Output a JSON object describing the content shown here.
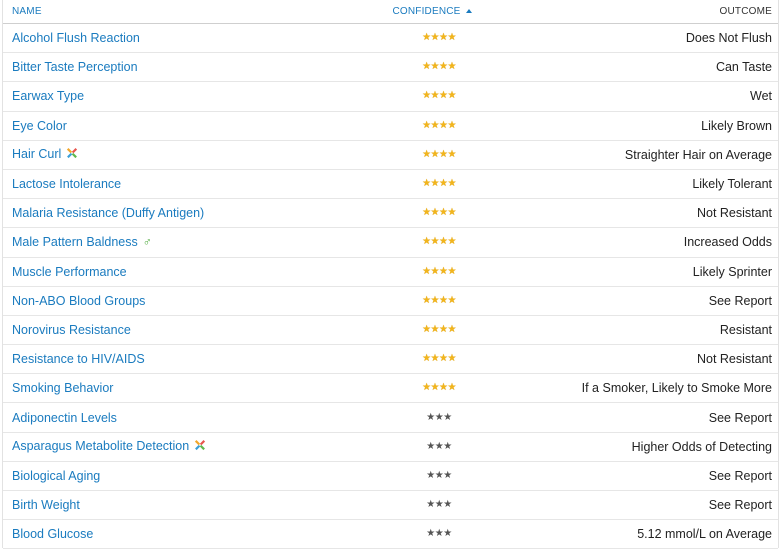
{
  "header": {
    "name_label": "NAME",
    "confidence_label": "CONFIDENCE",
    "outcome_label": "OUTCOME",
    "sort_icon": "sort-ascending-icon"
  },
  "colors": {
    "link": "#1a7bbf",
    "star_high": "#f2b51c",
    "star_low": "#555555",
    "male_symbol": "#4caa3a"
  },
  "rows": [
    {
      "name": "Alcohol Flush Reaction",
      "confidence": 4,
      "stars": "★★★★",
      "outcome": "Does Not Flush",
      "badge": ""
    },
    {
      "name": "Bitter Taste Perception",
      "confidence": 4,
      "stars": "★★★★",
      "outcome": "Can Taste",
      "badge": ""
    },
    {
      "name": "Earwax Type",
      "confidence": 4,
      "stars": "★★★★",
      "outcome": "Wet",
      "badge": ""
    },
    {
      "name": "Eye Color",
      "confidence": 4,
      "stars": "★★★★",
      "outcome": "Likely Brown",
      "badge": ""
    },
    {
      "name": "Hair Curl",
      "confidence": 4,
      "stars": "★★★★",
      "outcome": "Straighter Hair on Average",
      "badge": "multi-gene-icon"
    },
    {
      "name": "Lactose Intolerance",
      "confidence": 4,
      "stars": "★★★★",
      "outcome": "Likely Tolerant",
      "badge": ""
    },
    {
      "name": "Malaria Resistance (Duffy Antigen)",
      "confidence": 4,
      "stars": "★★★★",
      "outcome": "Not Resistant",
      "badge": ""
    },
    {
      "name": "Male Pattern Baldness",
      "confidence": 4,
      "stars": "★★★★",
      "outcome": "Increased Odds",
      "badge": "male-icon"
    },
    {
      "name": "Muscle Performance",
      "confidence": 4,
      "stars": "★★★★",
      "outcome": "Likely Sprinter",
      "badge": ""
    },
    {
      "name": "Non-ABO Blood Groups",
      "confidence": 4,
      "stars": "★★★★",
      "outcome": "See Report",
      "badge": ""
    },
    {
      "name": "Norovirus Resistance",
      "confidence": 4,
      "stars": "★★★★",
      "outcome": "Resistant",
      "badge": ""
    },
    {
      "name": "Resistance to HIV/AIDS",
      "confidence": 4,
      "stars": "★★★★",
      "outcome": "Not Resistant",
      "badge": ""
    },
    {
      "name": "Smoking Behavior",
      "confidence": 4,
      "stars": "★★★★",
      "outcome": "If a Smoker, Likely to Smoke More",
      "badge": ""
    },
    {
      "name": "Adiponectin Levels",
      "confidence": 3,
      "stars": "★★★",
      "outcome": "See Report",
      "badge": ""
    },
    {
      "name": "Asparagus Metabolite Detection",
      "confidence": 3,
      "stars": "★★★",
      "outcome": "Higher Odds of Detecting",
      "badge": "multi-gene-icon"
    },
    {
      "name": "Biological Aging",
      "confidence": 3,
      "stars": "★★★",
      "outcome": "See Report",
      "badge": ""
    },
    {
      "name": "Birth Weight",
      "confidence": 3,
      "stars": "★★★",
      "outcome": "See Report",
      "badge": ""
    },
    {
      "name": "Blood Glucose",
      "confidence": 3,
      "stars": "★★★",
      "outcome": "5.12 mmol/L on Average",
      "badge": ""
    }
  ]
}
